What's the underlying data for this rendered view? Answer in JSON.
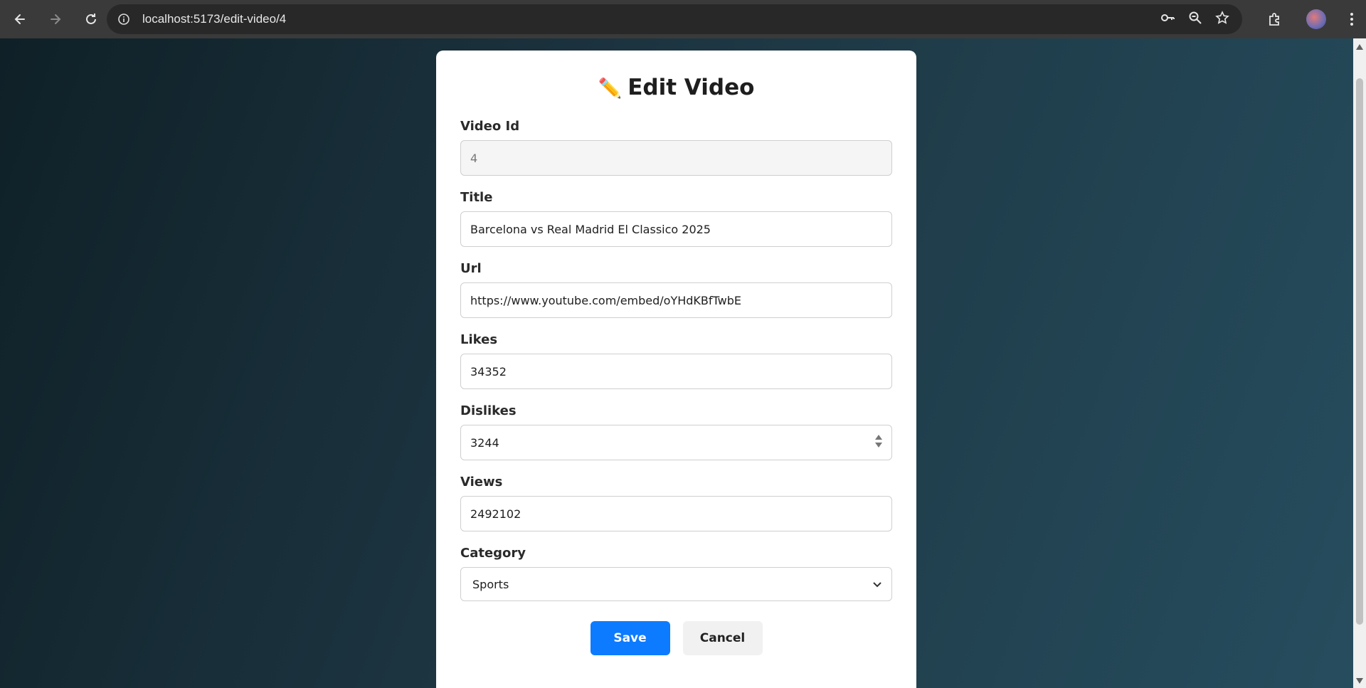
{
  "browser": {
    "url": "localhost:5173/edit-video/4"
  },
  "form": {
    "title": "Edit Video",
    "fields": {
      "video_id": {
        "label": "Video Id",
        "value": "4"
      },
      "title": {
        "label": "Title",
        "value": "Barcelona vs Real Madrid El Classico 2025"
      },
      "url": {
        "label": "Url",
        "value": "https://www.youtube.com/embed/oYHdKBfTwbE"
      },
      "likes": {
        "label": "Likes",
        "value": "34352"
      },
      "dislikes": {
        "label": "Dislikes",
        "value": "3244"
      },
      "views": {
        "label": "Views",
        "value": "2492102"
      },
      "category": {
        "label": "Category",
        "value": "Sports"
      }
    },
    "save_label": "Save",
    "cancel_label": "Cancel"
  },
  "icons": {
    "back": "arrow-left-icon",
    "forward": "arrow-right-icon",
    "reload": "reload-icon",
    "info": "info-icon",
    "key": "key-icon",
    "zoom": "zoom-icon",
    "star": "star-icon",
    "extensions": "puzzle-icon",
    "menu": "kebab-menu-icon",
    "title": "pencil-icon"
  },
  "colors": {
    "primary": "#0d7bff",
    "cancel_bg": "#f1f1f1"
  }
}
